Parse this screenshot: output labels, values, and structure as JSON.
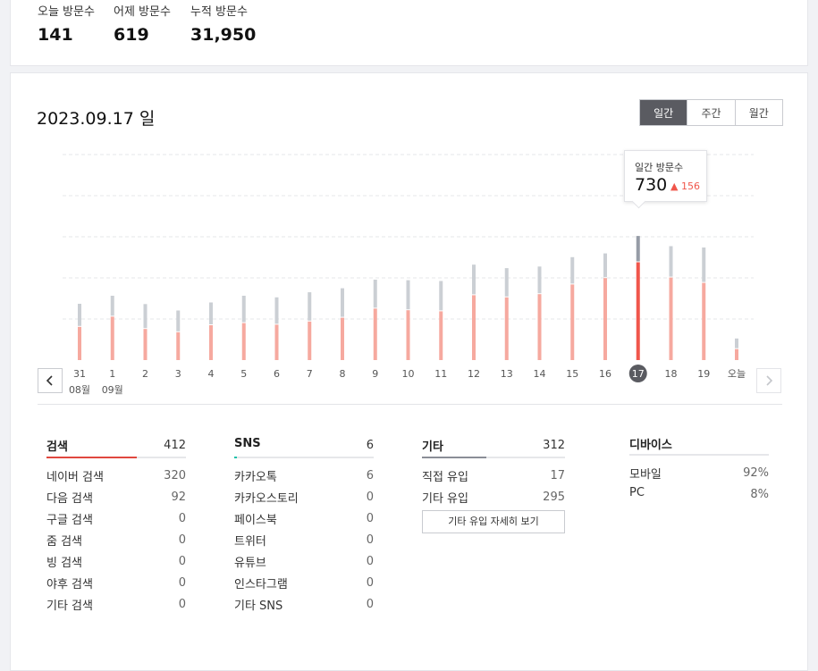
{
  "summary": {
    "today_label": "오늘 방문수",
    "today_value": "141",
    "yesterday_label": "어제 방문수",
    "yesterday_value": "619",
    "total_label": "누적 방문수",
    "total_value": "31,950"
  },
  "date_title": "2023.09.17 일",
  "period_tabs": [
    {
      "label": "일간",
      "active": true
    },
    {
      "label": "주간",
      "active": false
    },
    {
      "label": "월간",
      "active": false
    }
  ],
  "tooltip": {
    "label": "일간 방문수",
    "value": "730",
    "delta": "156"
  },
  "chart_data": {
    "type": "bar",
    "categories": [
      "31",
      "1",
      "2",
      "3",
      "4",
      "5",
      "6",
      "7",
      "8",
      "9",
      "10",
      "11",
      "12",
      "13",
      "14",
      "15",
      "16",
      "17",
      "18",
      "19",
      "오늘"
    ],
    "month_labels": [
      {
        "index": 0,
        "label": "08월"
      },
      {
        "index": 1,
        "label": "09월"
      }
    ],
    "selected": "17",
    "series": [
      {
        "values": [
          248,
          324,
          232,
          208,
          260,
          276,
          264,
          288,
          316,
          384,
          372,
          364,
          484,
          468,
          492,
          564,
          612,
          730,
          616,
          576,
          82
        ]
      },
      {
        "values": [
          420,
          480,
          418,
          370,
          430,
          480,
          468,
          506,
          536,
          600,
          596,
          590,
          712,
          686,
          698,
          768,
          796,
          926,
          850,
          840,
          161
        ]
      }
    ],
    "colors": {
      "lower": "#f6a99f",
      "upper": "#cbcfd4",
      "selected_lower": "#f0564b",
      "selected_upper": "#969ca6"
    },
    "grid": true
  },
  "panels": {
    "search": {
      "title": "검색",
      "total": "412",
      "bar_color": "#e0483f",
      "bar_fraction": 0.65,
      "rows": [
        {
          "label": "네이버 검색",
          "value": "320"
        },
        {
          "label": "다음 검색",
          "value": "92"
        },
        {
          "label": "구글 검색",
          "value": "0"
        },
        {
          "label": "줌 검색",
          "value": "0"
        },
        {
          "label": "빙 검색",
          "value": "0"
        },
        {
          "label": "야후 검색",
          "value": "0"
        },
        {
          "label": "기타 검색",
          "value": "0"
        }
      ]
    },
    "sns": {
      "title": "SNS",
      "total": "6",
      "bar_color": "#1ec1a9",
      "bar_fraction": 0.02,
      "rows": [
        {
          "label": "카카오톡",
          "value": "6"
        },
        {
          "label": "카카오스토리",
          "value": "0"
        },
        {
          "label": "페이스북",
          "value": "0"
        },
        {
          "label": "트위터",
          "value": "0"
        },
        {
          "label": "유튜브",
          "value": "0"
        },
        {
          "label": "인스타그램",
          "value": "0"
        },
        {
          "label": "기타 SNS",
          "value": "0"
        }
      ]
    },
    "etc": {
      "title": "기타",
      "total": "312",
      "bar_color": "#8a8e97",
      "bar_fraction": 0.45,
      "rows": [
        {
          "label": "직접 유입",
          "value": "17"
        },
        {
          "label": "기타 유입",
          "value": "295"
        }
      ],
      "more_button": "기타 유입 자세히 보기"
    },
    "device": {
      "title": "디바이스",
      "rows": [
        {
          "label": "모바일",
          "value": "92%"
        },
        {
          "label": "PC",
          "value": "8%"
        }
      ]
    }
  }
}
